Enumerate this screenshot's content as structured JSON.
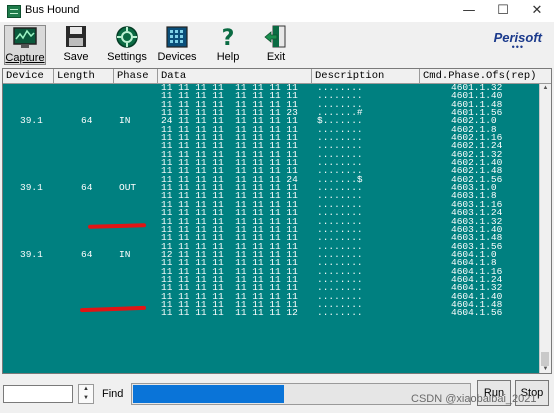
{
  "window": {
    "title": "Bus Hound",
    "minimize": "—",
    "maximize": "☐",
    "close": "✕"
  },
  "toolbar": {
    "capture": "Capture",
    "save": "Save",
    "settings": "Settings",
    "devices": "Devices",
    "help": "Help",
    "exit": "Exit"
  },
  "logo": {
    "name": "Perisoft",
    "dots": "•••"
  },
  "columns": {
    "device": "Device",
    "length": "Length",
    "phase": "Phase",
    "data": "Data",
    "description": "Description",
    "cmd": "Cmd.Phase.Ofs(rep)"
  },
  "rows": [
    {
      "dev": "",
      "len": "",
      "ph": "",
      "data": "11 11 11 11  11 11 11 11",
      "desc": "........",
      "cmd": "4601.1.32"
    },
    {
      "dev": "",
      "len": "",
      "ph": "",
      "data": "11 11 11 11  11 11 11 11",
      "desc": "........",
      "cmd": "4601.1.40"
    },
    {
      "dev": "",
      "len": "",
      "ph": "",
      "data": "11 11 11 11  11 11 11 11",
      "desc": "........",
      "cmd": "4601.1.48"
    },
    {
      "dev": "",
      "len": "",
      "ph": "",
      "data": "11 11 11 11  11 11 11 23",
      "desc": ".......#",
      "cmd": "4601.1.56"
    },
    {
      "dev": "39.1",
      "len": "64",
      "ph": "IN",
      "data": "24 11 11 11  11 11 11 11",
      "desc": "$.......",
      "cmd": "4602.1.0"
    },
    {
      "dev": "",
      "len": "",
      "ph": "",
      "data": "11 11 11 11  11 11 11 11",
      "desc": "........",
      "cmd": "4602.1.8"
    },
    {
      "dev": "",
      "len": "",
      "ph": "",
      "data": "11 11 11 11  11 11 11 11",
      "desc": "........",
      "cmd": "4602.1.16"
    },
    {
      "dev": "",
      "len": "",
      "ph": "",
      "data": "11 11 11 11  11 11 11 11",
      "desc": "........",
      "cmd": "4602.1.24"
    },
    {
      "dev": "",
      "len": "",
      "ph": "",
      "data": "11 11 11 11  11 11 11 11",
      "desc": "........",
      "cmd": "4602.1.32"
    },
    {
      "dev": "",
      "len": "",
      "ph": "",
      "data": "11 11 11 11  11 11 11 11",
      "desc": "........",
      "cmd": "4602.1.40"
    },
    {
      "dev": "",
      "len": "",
      "ph": "",
      "data": "11 11 11 11  11 11 11 11",
      "desc": "........",
      "cmd": "4602.1.48"
    },
    {
      "dev": "",
      "len": "",
      "ph": "",
      "data": "11 11 11 11  11 11 11 24",
      "desc": ".......$",
      "cmd": "4602.1.56"
    },
    {
      "dev": "39.1",
      "len": "64",
      "ph": "OUT",
      "data": "11 11 11 11  11 11 11 11",
      "desc": "........",
      "cmd": "4603.1.0"
    },
    {
      "dev": "",
      "len": "",
      "ph": "",
      "data": "11 11 11 11  11 11 11 11",
      "desc": "........",
      "cmd": "4603.1.8"
    },
    {
      "dev": "",
      "len": "",
      "ph": "",
      "data": "11 11 11 11  11 11 11 11",
      "desc": "........",
      "cmd": "4603.1.16"
    },
    {
      "dev": "",
      "len": "",
      "ph": "",
      "data": "11 11 11 11  11 11 11 11",
      "desc": "........",
      "cmd": "4603.1.24"
    },
    {
      "dev": "",
      "len": "",
      "ph": "",
      "data": "11 11 11 11  11 11 11 11",
      "desc": "........",
      "cmd": "4603.1.32"
    },
    {
      "dev": "",
      "len": "",
      "ph": "",
      "data": "11 11 11 11  11 11 11 11",
      "desc": "........",
      "cmd": "4603.1.40"
    },
    {
      "dev": "",
      "len": "",
      "ph": "",
      "data": "11 11 11 11  11 11 11 11",
      "desc": "........",
      "cmd": "4603.1.48"
    },
    {
      "dev": "",
      "len": "",
      "ph": "",
      "data": "11 11 11 11  11 11 11 11",
      "desc": "........",
      "cmd": "4603.1.56"
    },
    {
      "dev": "39.1",
      "len": "64",
      "ph": "IN",
      "data": "12 11 11 11  11 11 11 11",
      "desc": "........",
      "cmd": "4604.1.0"
    },
    {
      "dev": "",
      "len": "",
      "ph": "",
      "data": "11 11 11 11  11 11 11 11",
      "desc": "........",
      "cmd": "4604.1.8"
    },
    {
      "dev": "",
      "len": "",
      "ph": "",
      "data": "11 11 11 11  11 11 11 11",
      "desc": "........",
      "cmd": "4604.1.16"
    },
    {
      "dev": "",
      "len": "",
      "ph": "",
      "data": "11 11 11 11  11 11 11 11",
      "desc": "........",
      "cmd": "4604.1.24"
    },
    {
      "dev": "",
      "len": "",
      "ph": "",
      "data": "11 11 11 11  11 11 11 11",
      "desc": "........",
      "cmd": "4604.1.32"
    },
    {
      "dev": "",
      "len": "",
      "ph": "",
      "data": "11 11 11 11  11 11 11 11",
      "desc": "........",
      "cmd": "4604.1.40"
    },
    {
      "dev": "",
      "len": "",
      "ph": "",
      "data": "11 11 11 11  11 11 11 11",
      "desc": "........",
      "cmd": "4604.1.48"
    },
    {
      "dev": "",
      "len": "",
      "ph": "",
      "data": "11 11 11 11  11 11 11 12",
      "desc": "........",
      "cmd": "4604.1.56"
    }
  ],
  "bottom": {
    "find_label": "Find",
    "find_value": "",
    "progress_fraction": 0.45,
    "run": "Run",
    "stop": "Stop"
  },
  "watermark": "CSDN @xiaobaibai_2021",
  "colors": {
    "grid_bg": "#008080",
    "annotation_red": "#e11414",
    "progress": "#0a74d8"
  }
}
